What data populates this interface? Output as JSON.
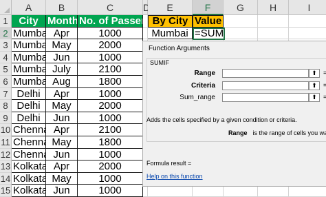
{
  "columns": [
    "A",
    "B",
    "C",
    "D",
    "E",
    "F",
    "G",
    "H",
    "I"
  ],
  "rows": [
    "1",
    "2",
    "3",
    "4",
    "5",
    "6",
    "7",
    "8",
    "9",
    "10",
    "11",
    "12",
    "13",
    "14",
    "15"
  ],
  "table": {
    "headers": [
      "City",
      "Month",
      "No. of Passenger"
    ],
    "rows": [
      [
        "Mumbai",
        "Apr",
        "1000"
      ],
      [
        "Mumbai",
        "May",
        "2000"
      ],
      [
        "Mumbai",
        "Jun",
        "1000"
      ],
      [
        "Mumbai",
        "July",
        "2100"
      ],
      [
        "Mumbai",
        "Aug",
        "1800"
      ],
      [
        "Delhi",
        "Apr",
        "1000"
      ],
      [
        "Delhi",
        "May",
        "2000"
      ],
      [
        "Delhi",
        "Jun",
        "1000"
      ],
      [
        "Chennai",
        "Apr",
        "2100"
      ],
      [
        "Chennai",
        "May",
        "1800"
      ],
      [
        "Chennai",
        "Jun",
        "1000"
      ],
      [
        "Kolkata",
        "Apr",
        "2000"
      ],
      [
        "Kolkata",
        "May",
        "1000"
      ],
      [
        "Kolkata",
        "Jun",
        "1000"
      ]
    ]
  },
  "summary": {
    "header_city": "By City",
    "header_value": "Value",
    "city": "Mumbai",
    "formula": "=SUMIF()"
  },
  "dialog": {
    "title": "Function Arguments",
    "function_name": "SUMIF",
    "args": [
      "Range",
      "Criteria",
      "Sum_range"
    ],
    "eq": "=",
    "description": "Adds the cells specified by a given condition or criteria.",
    "arg_desc_name": "Range",
    "arg_desc_text": "is the range of cells you want",
    "formula_result": "Formula result =",
    "help_link": "Help on this function",
    "icon_glyph": "⬆"
  },
  "colors": {
    "header_green": "#00a550",
    "summary_yellow": "#ffc000",
    "excel_green": "#217346",
    "link_blue": "#0645ad"
  }
}
